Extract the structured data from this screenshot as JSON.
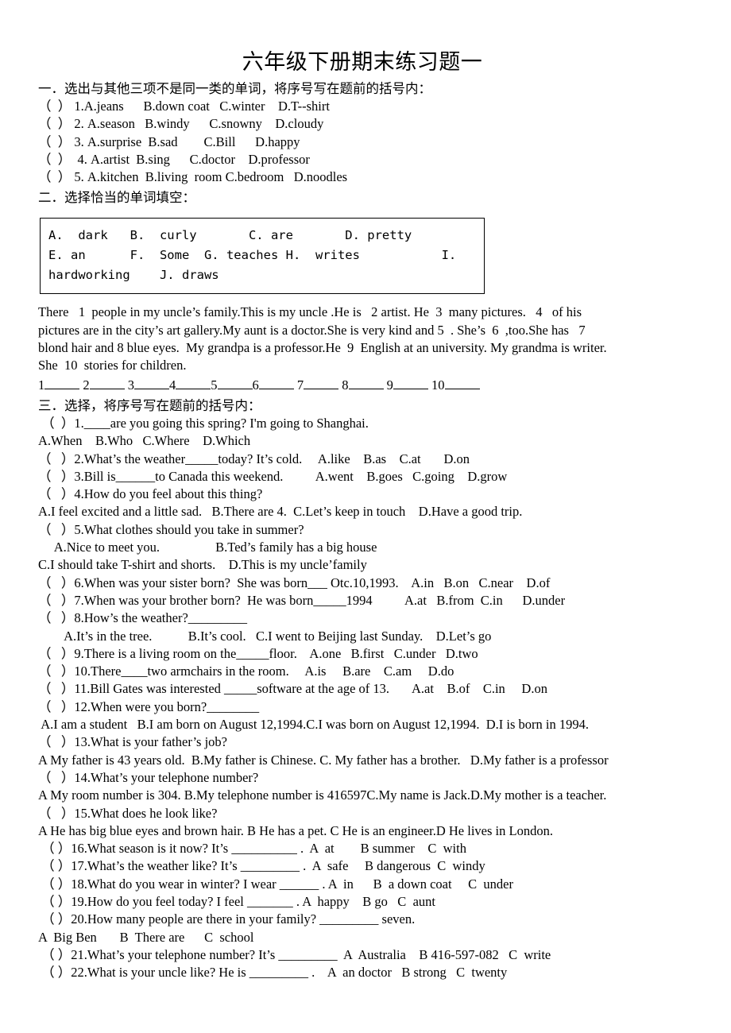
{
  "document": {
    "title": "六年级下册期末练习题一"
  },
  "section1": {
    "heading": "一．选出与其他三项不是同一类的单词，将序号写在题前的括号内：",
    "items": [
      "（  ） 1.A.jeans      B.down coat   C.winter    D.T--shirt",
      "（  ） 2. A.season   B.windy      C.snowny    D.cloudy",
      "（  ） 3. A.surprise  B.sad        C.Bill      D.happy",
      "（  ）  4. A.artist  B.sing      C.doctor    D.professor",
      "（  ） 5. A.kitchen  B.living  room C.bedroom   D.noodles"
    ]
  },
  "section2": {
    "heading": "二．选择恰当的单词填空：",
    "wordbank": [
      "A.  dark   B.  curly       C. are       D. pretty",
      "E. an      F.  Some  G. teaches H.  writes           I.",
      "hardworking    J. draws"
    ],
    "passage_lines": [
      "There   1  people in my uncle’s family.This is my uncle .He is   2 artist. He  3  many pictures.   4   of his",
      "pictures are in the city’s art gallery.My aunt is a doctor.She is very kind and 5  . She’s  6  ,too.She has   7",
      "blond hair and 8 blue eyes.  My grandpa is a professor.He  9  English at an university. My grandma is writer.",
      "She  10  stories for children."
    ],
    "answer_numbers": [
      "1",
      "2",
      "3",
      "4",
      "5",
      "6",
      "7",
      "8",
      "9",
      "10"
    ]
  },
  "section3": {
    "heading": "三．选择，将序号写在题前的括号内：",
    "lines": [
      " （  ）1.____are you going this spring? I'm going to Shanghai.",
      "A.When    B.Who   C.Where    D.Which",
      "（   ）2.What’s the weather_____today? It’s cold.     A.like    B.as    C.at       D.on",
      "（   ）3.Bill is______to Canada this weekend.          A.went    B.goes   C.going    D.grow",
      "（   ）4.How do you feel about this thing?",
      "A.I feel excited and a little sad.   B.There are 4.  C.Let’s keep in touch    D.Have a good trip.",
      "（   ）5.What clothes should you take in summer?",
      "     A.Nice to meet you.                 B.Ted’s family has a big house",
      "C.I should take T-shirt and shorts.    D.This is my uncle’family",
      "（   ）6.When was your sister born?  She was born___ Otc.10,1993.    A.in   B.on   C.near    D.of",
      "（   ）7.When was your brother born?  He was born_____1994          A.at   B.from  C.in      D.under",
      "（   ）8.How’s the weather?_________",
      "        A.It’s in the tree.           B.It’s cool.   C.I went to Beijing last Sunday.    D.Let’s go",
      "（   ）9.There is a living room on the_____floor.    A.one   B.first   C.under   D.two",
      "（   ）10.There____two armchairs in the room.     A.is     B.are    C.am     D.do",
      "（   ）11.Bill Gates was interested _____software at the age of 13.       A.at    B.of    C.in     D.on",
      "（   ）12.When were you born?________",
      " A.I am a student   B.I am born on August 12,1994.C.I was born on August 12,1994.  D.I is born in 1994.",
      "（   ）13.What is your father’s job?",
      "A My father is 43 years old.  B.My father is Chinese. C. My father has a brother.   D.My father is a professor",
      "（   ）14.What’s your telephone number?",
      "A My room number is 304. B.My telephone number is 416597C.My name is Jack.D.My mother is a teacher.",
      "（   ）15.What does he look like?",
      "A He has big blue eyes and brown hair. B He has a pet. C He is an engineer.D He lives in London.",
      " （ ）16.What season is it now? It’s __________ .  A  at        B summer    C  with",
      " （ ）17.What’s the weather like? It’s _________ .  A  safe     B dangerous  C  windy",
      " （ ）18.What do you wear in winter? I wear ______ . A  in      B  a down coat     C  under",
      " （ ）19.How do you feel today? I feel _______ . A  happy    B go   C  aunt",
      " （ ）20.How many people are there in your family? _________ seven.",
      "A  Big Ben       B  There are      C  school",
      " （ ）21.What’s your telephone number? It’s _________  A  Australia    B 416-597-082   C  write",
      " （ ）22.What is your uncle like? He is _________ .    A  an doctor   B strong   C  twenty"
    ]
  }
}
